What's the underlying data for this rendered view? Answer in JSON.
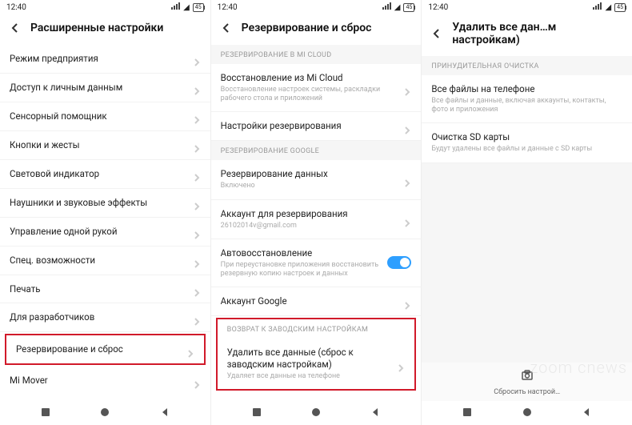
{
  "status": {
    "time": "12:40",
    "battery": "45"
  },
  "screen1": {
    "title": "Расширенные настройки",
    "items": [
      "Режим предприятия",
      "Доступ к личным данным",
      "Сенсорный помощник",
      "Кнопки и жесты",
      "Световой индикатор",
      "Наушники и звуковые эффекты",
      "Управление одной рукой",
      "Спец. возможности",
      "Печать",
      "Для разработчиков",
      "Резервирование и сброс",
      "Mi Mover"
    ]
  },
  "screen2": {
    "title": "Резервирование и сброс",
    "sec1": "РЕЗЕРВИРОВАНИЕ В MI CLOUD",
    "r1_title": "Восстановление из Mi Cloud",
    "r1_sub": "Восстановление настроек системы, раскладки рабочего стола и приложений",
    "r2_title": "Настройки резервирования",
    "sec2": "РЕЗЕРВИРОВАНИЕ GOOGLE",
    "r3_title": "Резервирование данных",
    "r3_sub": "Включено",
    "r4_title": "Аккаунт для резервирования",
    "r4_sub": "26102014v@gmail.com",
    "r5_title": "Автовосстановление",
    "r5_sub": "При переустановке приложения восстановить резервную копию настроек и данных",
    "r6_title": "Аккаунт Google",
    "sec3": "ВОЗВРАТ К ЗАВОДСКИМ НАСТРОЙКАМ",
    "r7_title": "Удалить все данные (сброс к заводским настройкам)",
    "r7_sub": "Удаляет все данные на телефоне"
  },
  "screen3": {
    "title": "Удалить все дан…м настройкам)",
    "sec1": "ПРИНУДИТЕЛЬНАЯ ОЧИСТКА",
    "r1_title": "Все файлы на телефоне",
    "r1_sub": "Все файлы и данные, включая аккаунты, контакты, фото и приложения",
    "r2_title": "Очистка SD карты",
    "r2_sub": "Будут удалены все файлы и данные с SD карты",
    "action": "Сбросить настрой…"
  },
  "watermark": "zoom cnews"
}
